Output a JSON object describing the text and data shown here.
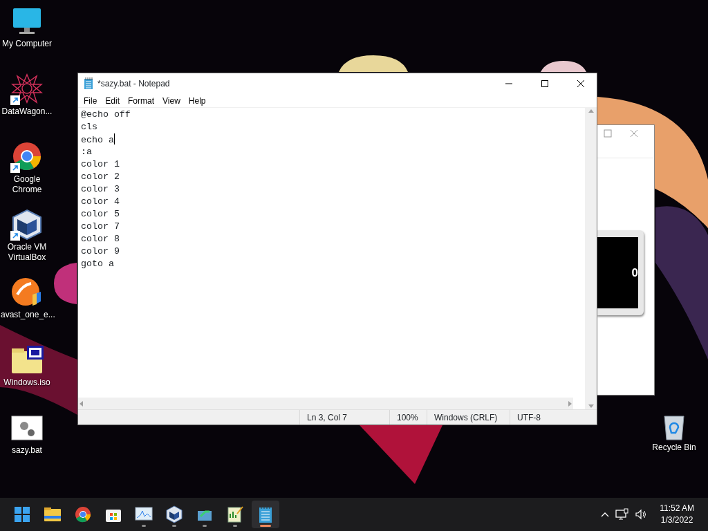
{
  "desktop_icons": [
    {
      "kind": "monitor",
      "label": "My Computer",
      "shortcut": false
    },
    {
      "kind": "star",
      "label": "DataWagon...",
      "shortcut": true
    },
    {
      "kind": "chrome",
      "label": "Google Chrome",
      "shortcut": true
    },
    {
      "kind": "vbox",
      "label": "Oracle VM VirtualBox",
      "shortcut": true
    },
    {
      "kind": "avast",
      "label": "avast_one_e...",
      "shortcut": false
    },
    {
      "kind": "iso",
      "label": "Windows.iso",
      "shortcut": false
    },
    {
      "kind": "bat",
      "label": "sazy.bat",
      "shortcut": false
    }
  ],
  "recycle_bin": {
    "label": "Recycle Bin"
  },
  "back_window": {
    "panel_text": "0"
  },
  "notepad": {
    "title": "*sazy.bat - Notepad",
    "menu": [
      "File",
      "Edit",
      "Format",
      "View",
      "Help"
    ],
    "lines": [
      {
        "text": "@echo off",
        "cursor": false
      },
      {
        "text": "cls",
        "cursor": false
      },
      {
        "text": "echo a",
        "cursor": true
      },
      {
        "text": ":a",
        "cursor": false
      },
      {
        "text": "color 1",
        "cursor": false
      },
      {
        "text": "color 2",
        "cursor": false
      },
      {
        "text": "color 3",
        "cursor": false
      },
      {
        "text": "color 4",
        "cursor": false
      },
      {
        "text": "color 5",
        "cursor": false
      },
      {
        "text": "color 7",
        "cursor": false
      },
      {
        "text": "color 8",
        "cursor": false
      },
      {
        "text": "color 9",
        "cursor": false
      },
      {
        "text": "goto a",
        "cursor": false
      }
    ],
    "status_bar": [
      "Ln 3, Col 7",
      "100%",
      "Windows (CRLF)",
      "UTF-8"
    ]
  },
  "taskbar": {
    "apps": [
      {
        "kind": "start",
        "running": false,
        "selected": false
      },
      {
        "kind": "folder",
        "running": false,
        "selected": false
      },
      {
        "kind": "chrome",
        "running": false,
        "selected": false
      },
      {
        "kind": "store",
        "running": false,
        "selected": false
      },
      {
        "kind": "monitor-chart",
        "running": true,
        "selected": false
      },
      {
        "kind": "vbox",
        "running": true,
        "selected": false
      },
      {
        "kind": "transfer",
        "running": true,
        "selected": false
      },
      {
        "kind": "notes",
        "running": true,
        "selected": false
      },
      {
        "kind": "notepad",
        "running": true,
        "selected": true
      }
    ],
    "time": "11:52 AM",
    "date": "1/3/2022"
  }
}
